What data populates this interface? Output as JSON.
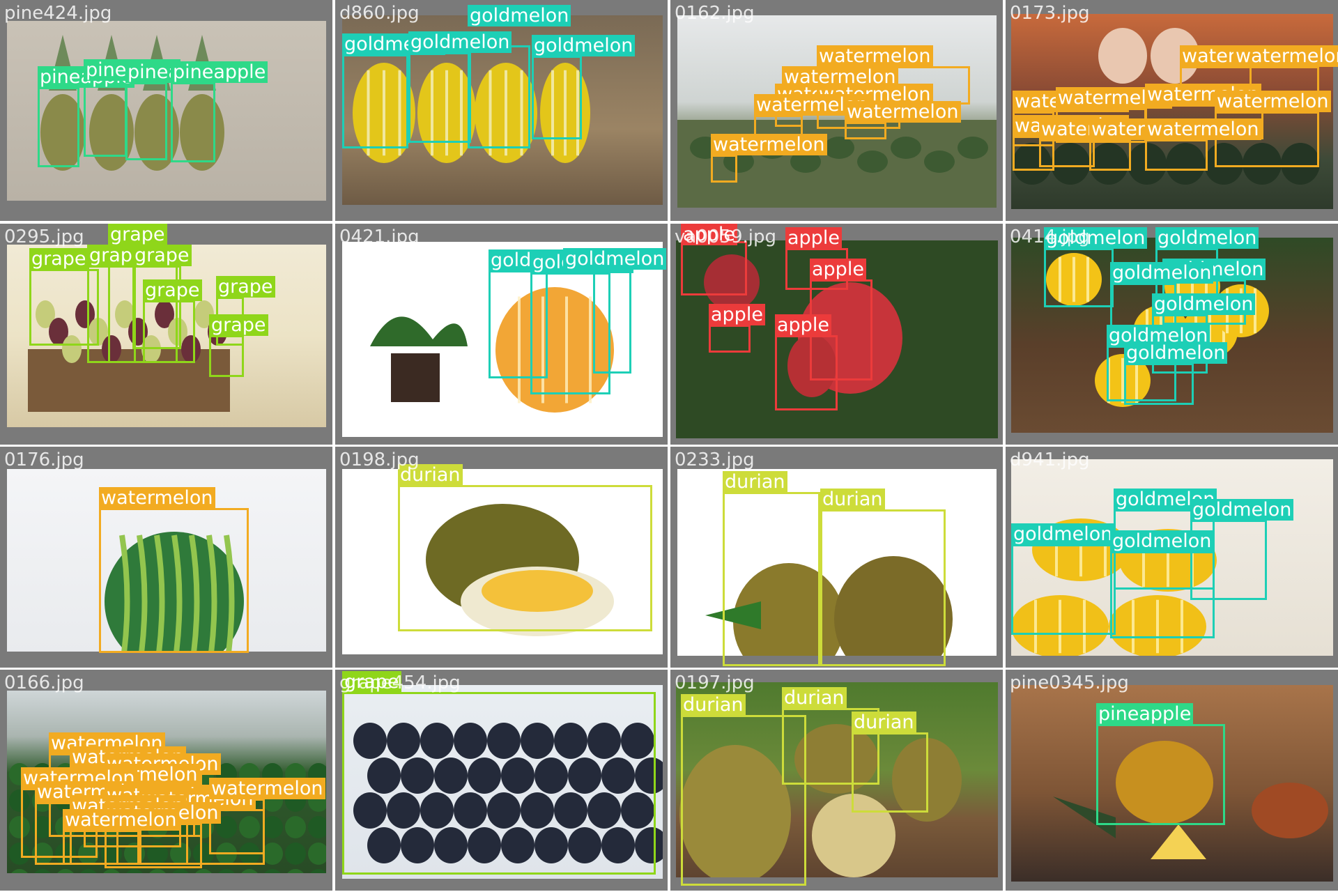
{
  "colors": {
    "goldmelon": "#1dcfb6",
    "watermelon": "#f2ab21",
    "pineapple": "#2ed988",
    "grape": "#8fd61a",
    "apple": "#ec3b3b",
    "durian": "#cddc3a",
    "tile_bg": "#7a7a7a"
  },
  "tiles": [
    {
      "filename": "pine424.jpg",
      "bg": "linear-gradient(180deg,#c9c2b6,#b9b2a6)",
      "labels": [
        "pineapple",
        "pineapple",
        "pineapple",
        "pineapple"
      ]
    },
    {
      "filename": "d860.jpg",
      "bg": "linear-gradient(180deg,#7a6a55,#9b8464 60%,#6e5b45)",
      "labels": [
        "goldmelon",
        "goldmelon",
        "goldmelon",
        "goldmelon"
      ]
    },
    {
      "filename": "0162.jpg",
      "bg": "linear-gradient(180deg,#e7e9ea,#cfd4d2 45%,#7e8b6d 62%,#5c6b4e)",
      "labels": [
        "watermelon",
        "watermelon",
        "watermelon",
        "watermelon",
        "watermelon",
        "watermelon",
        "watermelon"
      ]
    },
    {
      "filename": "0173.jpg",
      "bg": "linear-gradient(180deg,#c86a3c,#8a4b34 40%,#3d4a38 75%,#2e3a2b)",
      "labels": [
        "watermelon",
        "watermelon",
        "watermelon",
        "watermelon",
        "watermelon",
        "watermelon",
        "watermelon",
        "watermelon",
        "watermelon",
        "watermelon"
      ]
    },
    {
      "filename": "0295.jpg",
      "bg": "linear-gradient(180deg,#f1ead5,#ece3c6 50%,#d7c9a5)",
      "labels": [
        "grape",
        "grape",
        "grape",
        "grape",
        "grape",
        "grape",
        "grape"
      ]
    },
    {
      "filename": "0421.jpg",
      "bg": "#ffffff",
      "labels": [
        "goldmelon",
        "goldmelon",
        "goldmelon"
      ]
    },
    {
      "filename": "va0059.jpg",
      "bg": "linear-gradient(180deg,#3d5a2a,#2f4a22 50%,#23381a)",
      "labels": [
        "apple",
        "apple",
        "apple",
        "apple",
        "apple"
      ]
    },
    {
      "filename": "0414.jpg",
      "bg": "linear-gradient(180deg,#2f4a26,#5a3f2a 55%,#6a4b32)",
      "labels": [
        "goldmelon",
        "goldmelon",
        "goldmelon",
        "goldmelon",
        "goldmelon",
        "goldmelon",
        "goldmelon"
      ]
    },
    {
      "filename": "0176.jpg",
      "bg": "linear-gradient(180deg,#f4f5f7,#e9ebee)",
      "labels": [
        "watermelon"
      ]
    },
    {
      "filename": "0198.jpg",
      "bg": "#ffffff",
      "labels": [
        "durian"
      ]
    },
    {
      "filename": "0233.jpg",
      "bg": "#ffffff",
      "labels": [
        "durian",
        "durian"
      ]
    },
    {
      "filename": "d941.jpg",
      "bg": "linear-gradient(180deg,#f2eee6,#e6e0d4)",
      "labels": [
        "goldmelon",
        "goldmelon",
        "goldmelon",
        "goldmelon"
      ]
    },
    {
      "filename": "0166.jpg",
      "bg": "linear-gradient(180deg,#cfd6d8,#aab5b0 25%,#2f5a2c 45%,#284b25)",
      "labels": [
        "watermelon",
        "watermelon",
        "watermelon",
        "watermelon",
        "watermelon",
        "watermelon",
        "watermelon",
        "watermelon",
        "watermelon",
        "watermelon",
        "watermelon",
        "watermelon"
      ]
    },
    {
      "filename": "grape454.jpg",
      "bg": "linear-gradient(180deg,#e9eef2,#dfe4ea)",
      "labels": [
        "grape"
      ]
    },
    {
      "filename": "0197.jpg",
      "bg": "linear-gradient(180deg,#4f7a2e,#6b8a3a 45%,#7a5a3a 70%,#5e4430)",
      "labels": [
        "durian",
        "durian",
        "durian"
      ]
    },
    {
      "filename": "pine0345.jpg",
      "bg": "linear-gradient(180deg,#a8744a,#7e5536 55%,#3b2e28)",
      "labels": [
        "pineapple"
      ]
    }
  ]
}
